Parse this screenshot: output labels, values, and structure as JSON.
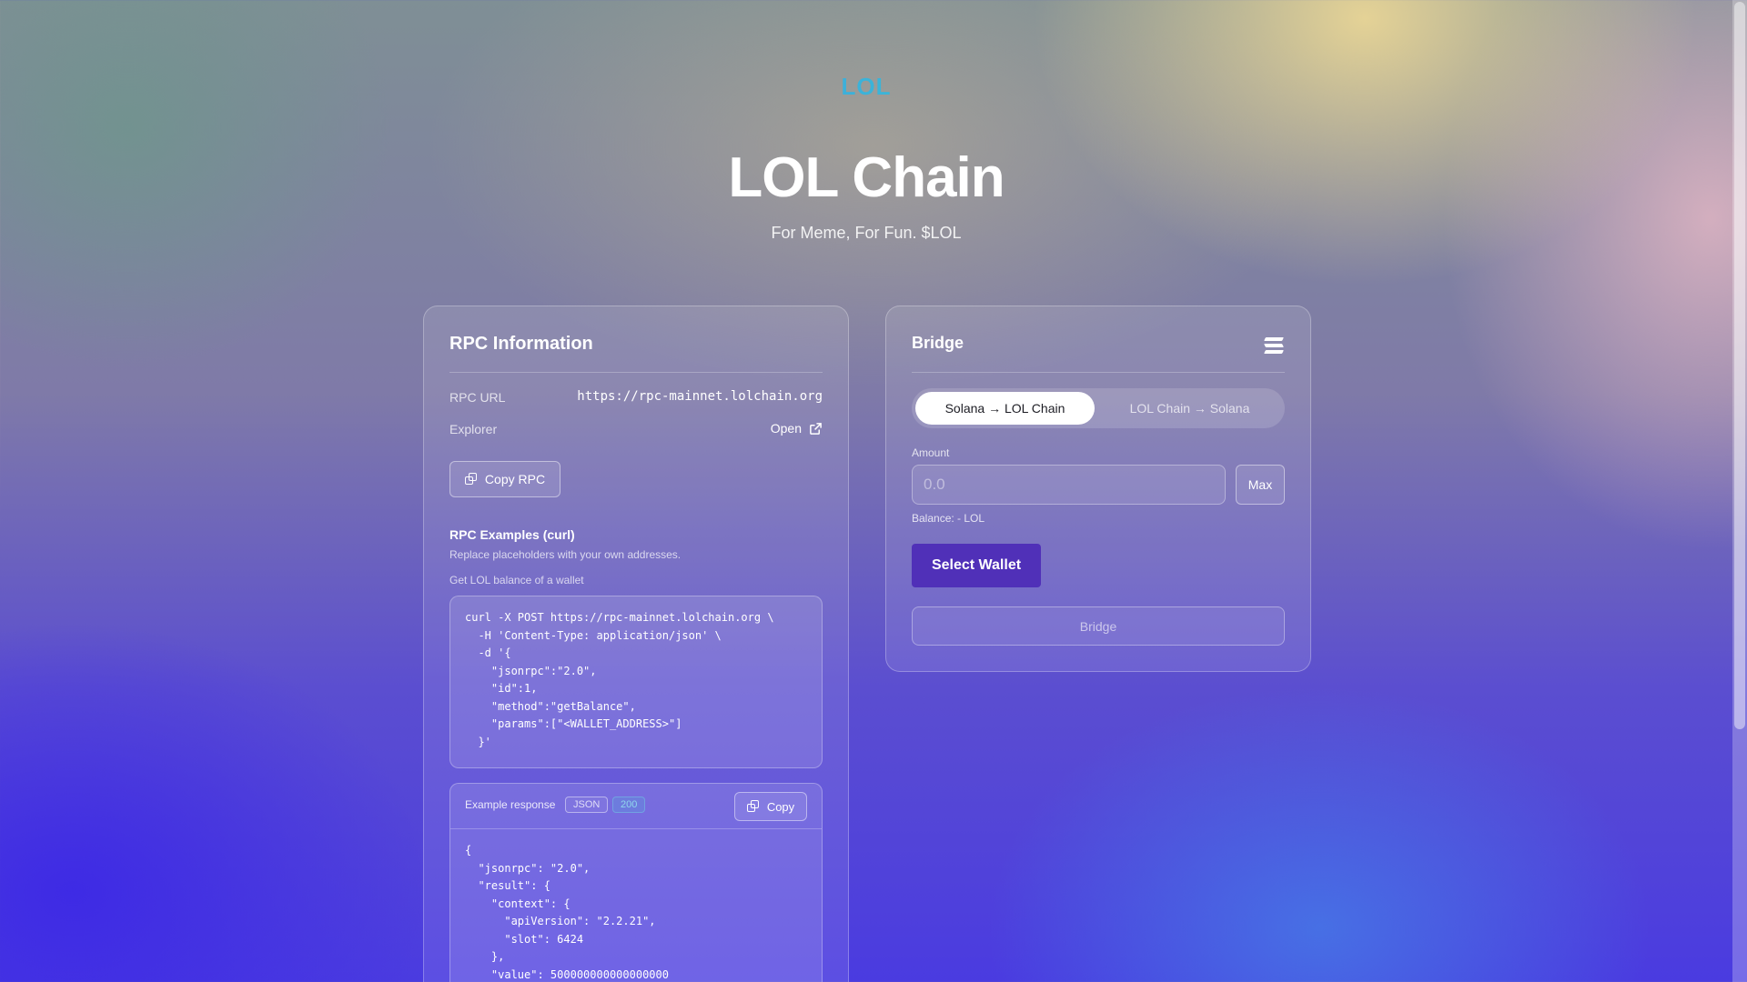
{
  "header": {
    "logo": "LOL",
    "title": "LOL Chain",
    "subtitle": "For Meme, For Fun. $LOL"
  },
  "rpc": {
    "title": "RPC Information",
    "url_label": "RPC URL",
    "url_value": "https://rpc-mainnet.lolchain.org",
    "explorer_label": "Explorer",
    "explorer_link": "Open",
    "copy_rpc": "Copy RPC",
    "examples_title": "RPC Examples (curl)",
    "examples_hint": "Replace placeholders with your own addresses.",
    "example_label": "Get LOL balance of a wallet",
    "example_code": "curl -X POST https://rpc-mainnet.lolchain.org \\\n  -H 'Content-Type: application/json' \\\n  -d '{\n    \"jsonrpc\":\"2.0\",\n    \"id\":1,\n    \"method\":\"getBalance\",\n    \"params\":[\"<WALLET_ADDRESS>\"]\n  }'",
    "response_label": "Example response",
    "response_format": "JSON",
    "response_status": "200",
    "response_copy": "Copy",
    "response_code": "{\n  \"jsonrpc\": \"2.0\",\n  \"result\": {\n    \"context\": {\n      \"apiVersion\": \"2.2.21\",\n      \"slot\": 6424\n    },\n    \"value\": 500000000000000000"
  },
  "bridge": {
    "title": "Bridge",
    "icon": "solana-icon",
    "tab_active": "Solana → LOL Chain",
    "tab_inactive": "LOL Chain → Solana",
    "amount_label": "Amount",
    "amount_placeholder": "0.0",
    "max_label": "Max",
    "balance": "Balance: - LOL",
    "select_wallet": "Select Wallet",
    "bridge_button": "Bridge"
  }
}
